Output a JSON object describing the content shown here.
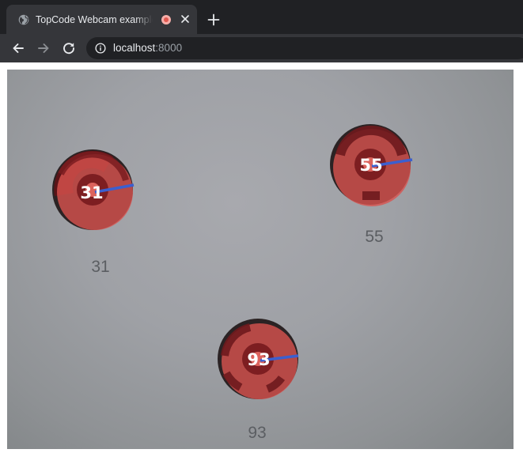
{
  "browser": {
    "tab": {
      "title": "TopCode Webcam example using",
      "favicon": "globe-icon",
      "recording_indicator": "recording-icon",
      "close_icon": "close-icon"
    },
    "new_tab_icon": "plus-icon",
    "nav": {
      "back_icon": "back-arrow-icon",
      "forward_icon": "forward-arrow-icon",
      "reload_icon": "reload-icon"
    },
    "omnibox": {
      "info_icon": "info-icon",
      "host": "localhost",
      "port": ":8000"
    }
  },
  "webcam": {
    "topcodes": [
      {
        "code": "31",
        "printed_label": "31",
        "overlay_color": "#d9534f",
        "direction_color": "#3b5fcf"
      },
      {
        "code": "55",
        "printed_label": "55",
        "overlay_color": "#d9534f",
        "direction_color": "#3b5fcf"
      },
      {
        "code": "93",
        "printed_label": "93",
        "overlay_color": "#d9534f",
        "direction_color": "#3b5fcf"
      }
    ]
  }
}
